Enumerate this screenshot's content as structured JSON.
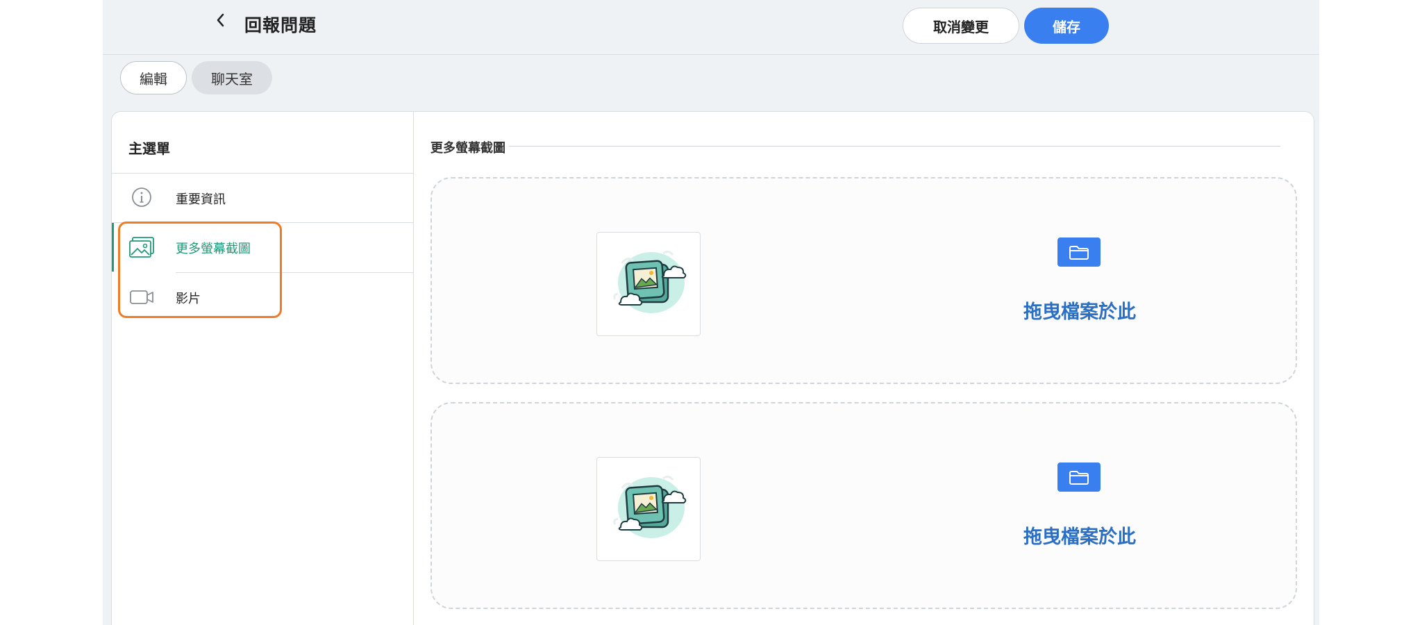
{
  "header": {
    "title": "回報問題",
    "cancel_label": "取消變更",
    "save_label": "儲存"
  },
  "tabs": [
    {
      "label": "編輯",
      "active": true
    },
    {
      "label": "聊天室",
      "active": false
    }
  ],
  "sidebar": {
    "title": "主選單",
    "items": [
      {
        "label": "重要資訊",
        "icon": "info-icon"
      },
      {
        "label": "更多螢幕截圖",
        "icon": "image-icon",
        "active": true
      },
      {
        "label": "影片",
        "icon": "video-icon"
      }
    ]
  },
  "main": {
    "section_title": "更多螢幕截圖",
    "dropzones": [
      {
        "text": "拖曳檔案於此",
        "icon": "folder-icon"
      },
      {
        "text": "拖曳檔案於此",
        "icon": "folder-icon"
      }
    ]
  },
  "colors": {
    "accent": "#3a7ff0",
    "active": "#1f9a77",
    "highlight": "#f07b22",
    "link": "#2a6fc4"
  }
}
